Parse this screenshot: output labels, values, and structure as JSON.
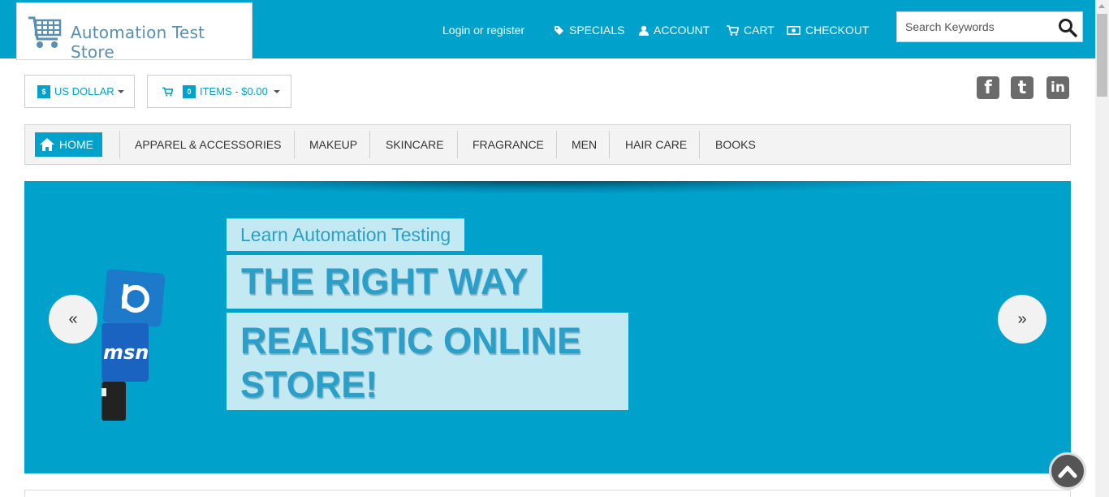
{
  "header": {
    "logo_text": "Automation Test Store",
    "links": {
      "login": "Login or register",
      "specials": "SPECIALS",
      "account": "ACCOUNT",
      "cart": "CART",
      "checkout": "CHECKOUT"
    },
    "search": {
      "placeholder": "Search Keywords",
      "value": ""
    }
  },
  "toolbar": {
    "currency_badge": "$",
    "currency_label": "US DOLLAR",
    "cart_count": "0",
    "cart_label": "ITEMS - $0.00"
  },
  "social": {
    "facebook": "f",
    "twitter": "t",
    "linkedin": "in"
  },
  "nav": {
    "home": "HOME",
    "items": [
      "APPAREL & ACCESSORIES",
      "MAKEUP",
      "SKINCARE",
      "FRAGRANCE",
      "MEN",
      "HAIR CARE",
      "BOOKS"
    ]
  },
  "banner": {
    "line1": "Learn Automation Testing",
    "line2": "THE RIGHT WAY",
    "line3": "REALISTIC ONLINE STORE!",
    "prev_glyph": "«",
    "next_glyph": "»"
  },
  "colors": {
    "accent": "#00a1cb",
    "nav_bg": "#f3f3f3",
    "banner_text": "#2c9fc8"
  },
  "icons": [
    "cart-logo-icon",
    "tag-icon",
    "user-icon",
    "cart-icon",
    "money-icon",
    "search-icon",
    "home-icon",
    "chevron-up-icon"
  ]
}
